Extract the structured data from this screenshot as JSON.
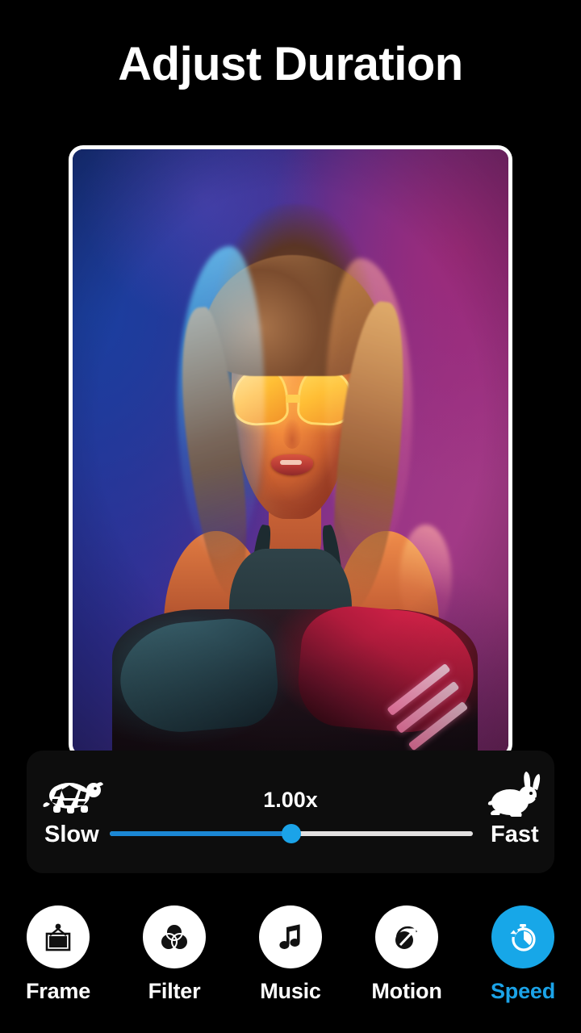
{
  "screen": {
    "title": "Adjust Duration",
    "background_color": "#000000",
    "accent_color": "#1ba3e8"
  },
  "preview": {
    "border_color": "#ffffff",
    "description": "Portrait photo of a woman wearing yellow cat-eye sunglasses under blue and magenta neon lighting"
  },
  "speed_panel": {
    "panel_color": "#0d0d0d",
    "value_label": "1.00x",
    "slow": {
      "label": "Slow",
      "icon": "turtle-icon"
    },
    "fast": {
      "label": "Fast",
      "icon": "rabbit-icon"
    },
    "slider": {
      "value_percent": 50,
      "fill_color": "#1b87d4",
      "track_color": "#e2e0e0",
      "thumb_color": "#1ba3e8"
    }
  },
  "toolbar": {
    "tabs": [
      {
        "label": "Frame",
        "icon": "frame-icon",
        "active": false
      },
      {
        "label": "Filter",
        "icon": "filter-icon",
        "active": false
      },
      {
        "label": "Music",
        "icon": "music-icon",
        "active": false
      },
      {
        "label": "Motion",
        "icon": "motion-icon",
        "active": false
      },
      {
        "label": "Speed",
        "icon": "speed-icon",
        "active": true
      }
    ]
  }
}
